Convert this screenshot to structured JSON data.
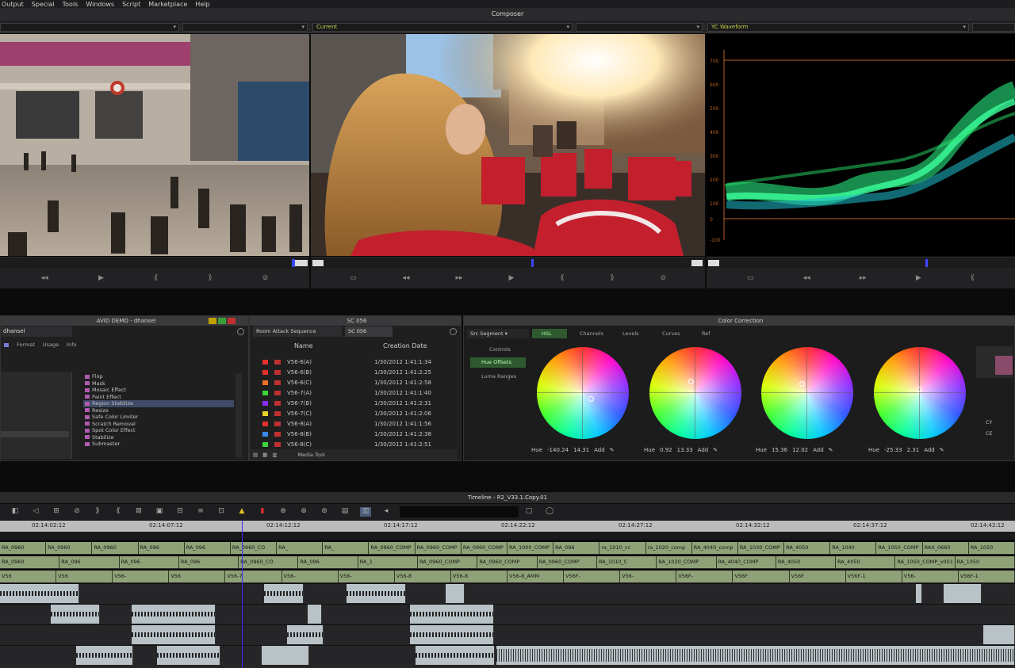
{
  "menu": [
    "Output",
    "Special",
    "Tools",
    "Windows",
    "Script",
    "Marketplace",
    "Help"
  ],
  "composer": {
    "title": "Composer",
    "monitors": [
      {
        "selector_left": "",
        "selector_right": ""
      },
      {
        "selector_left": "Current",
        "selector_right": ""
      },
      {
        "selector_left": "YC Waveform",
        "selector_right": ""
      }
    ],
    "waveform_scale": [
      "700",
      "600",
      "500",
      "400",
      "300",
      "200",
      "100",
      "0",
      "-100"
    ]
  },
  "bin": {
    "title": "AVID DEMO - dhansel",
    "tab": "dhansel",
    "tabs": [
      "Format",
      "Usage",
      "Info"
    ],
    "effects": [
      "Flop",
      "Mask",
      "Mosaic Effect",
      "Paint Effect",
      "Region Stabilize",
      "Resize",
      "Safe Color Limiter",
      "Scratch Removal",
      "Spot Color Effect",
      "Stabilize",
      "Submaster"
    ],
    "selected_effect": "Region Stabilize"
  },
  "sequence_bin": {
    "title": "SC 056",
    "tabs": [
      "Room Attack Sequence",
      "SC 056"
    ],
    "headers": [
      "Name",
      "Creation Date"
    ],
    "rows": [
      {
        "name": "V56-6(A)",
        "date": "1/30/2012 1:41:1:34",
        "color": "#e8302a"
      },
      {
        "name": "V56-6(B)",
        "date": "1/30/2012 1:41:2:25",
        "color": "#e8302a"
      },
      {
        "name": "V56-6(C)",
        "date": "1/30/2012 1:41:2:58",
        "color": "#e8702a"
      },
      {
        "name": "V56-7(A)",
        "date": "1/30/2012 1:41:1:40",
        "color": "#3ad43a"
      },
      {
        "name": "V56-7(B)",
        "date": "1/30/2012 1:41:2:31",
        "color": "#8a2cff"
      },
      {
        "name": "V56-7(C)",
        "date": "1/30/2012 1:41:2:06",
        "color": "#e8d02a"
      },
      {
        "name": "V56-8(A)",
        "date": "1/30/2012 1:41:1:56",
        "color": "#e8302a"
      },
      {
        "name": "V56-8(B)",
        "date": "1/30/2012 1:41:2:38",
        "color": "#3a8ae8"
      },
      {
        "name": "V56-8(C)",
        "date": "1/30/2012 1:41:2:51",
        "color": "#3ad43a"
      }
    ],
    "footer": "Media Tool"
  },
  "color_correction": {
    "title": "Color Correction",
    "mode": "Src Segment",
    "tabs": [
      "HSL",
      "Channels",
      "Levels",
      "Curves",
      "Ref"
    ],
    "side_tabs": [
      "Controls",
      "Hue Offsets",
      "Luma Ranges"
    ],
    "active_side": "Hue Offsets",
    "wheels": [
      {
        "label": "Hue",
        "hue": "-140.24",
        "val": "14.31"
      },
      {
        "label": "Hue",
        "hue": "0.92",
        "val": "13.33"
      },
      {
        "label": "Hue",
        "hue": "15.36",
        "val": "12.02"
      },
      {
        "label": "Hue",
        "hue": "-25.33",
        "val": "2.31"
      }
    ],
    "add_label": "Add",
    "right_labels": [
      "CY",
      "CE"
    ]
  },
  "timeline": {
    "title": "Timeline - R2_V33.1.Copy.01",
    "timecodes": [
      "02:14:02:12",
      "02:14:07:12",
      "02:14:12:12",
      "02:14:17:12",
      "02:14:22:12",
      "02:14:27:12",
      "02:14:32:12",
      "02:14:37:12",
      "02:14:42:12"
    ],
    "v3": [
      "RA_0960",
      "RA_0960",
      "RA_0960",
      "RA_096",
      "RA_096",
      "RA_0960_CO",
      "RA_",
      "RA_",
      "RA_0960_COMP",
      "RA_0960_COMP",
      "RA_0960_COMP",
      "RA_1000_COMP",
      "RA_096",
      "ra_1010_cc",
      "ra_1020_comp",
      "RA_4040_comp",
      "RA_1030_COMP",
      "RA_4050",
      "RA_1040",
      "RA_1050_COMP",
      "RAX_0660",
      "RA_1050"
    ],
    "v2": [
      "RA_0960",
      "RA_096",
      "RA_096",
      "RA_096",
      "RA_0960_CO",
      "RA_096",
      "RA_1",
      "RA_0960_COMP",
      "RA_0960_COMP",
      "RA_0960_COMP",
      "RA_1010_C",
      "RA_1020_COMP",
      "RA_4040_COMP",
      "RA_4050",
      "RA_4050",
      "RA_1050_COMP_v001",
      "RA_1050"
    ],
    "v1": [
      "V56",
      "V56",
      "V56-",
      "V56",
      "V56-7",
      "V56-",
      "V56-",
      "V56-8",
      "V56-8",
      "V56-8_AMM",
      "V56F-",
      "V56-",
      "V56F-",
      "V56F",
      "V56F",
      "V56F-1",
      "V56-",
      "V56F-1"
    ]
  }
}
